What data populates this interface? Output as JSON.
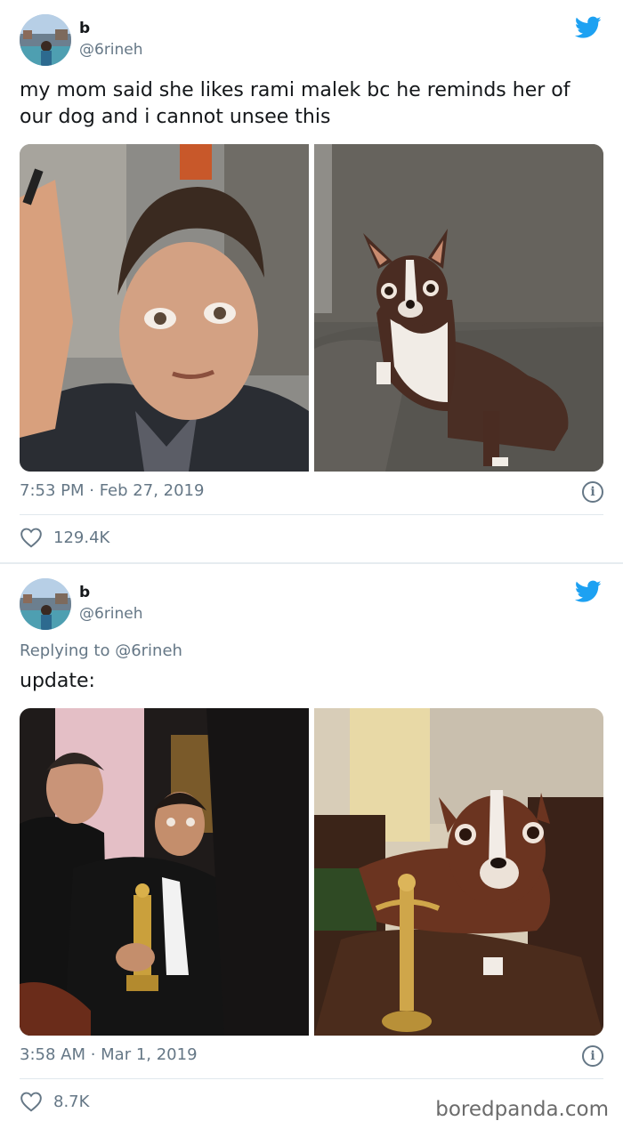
{
  "tweets": [
    {
      "author": {
        "name": "b",
        "handle": "@6rineh"
      },
      "reply_to": "",
      "text": "my mom said she likes rami malek bc he reminds her of our dog and i cannot unsee this",
      "timestamp": "7:53 PM · Feb 27, 2019",
      "likes": "129.4K"
    },
    {
      "author": {
        "name": "b",
        "handle": "@6rineh"
      },
      "reply_to": "Replying to @6rineh",
      "text": "update:",
      "timestamp": "3:58 AM · Mar 1, 2019",
      "likes": "8.7K"
    }
  ],
  "watermark": "boredpanda.com",
  "icons": {
    "brand": "twitter-bird-icon",
    "like": "heart-icon",
    "info": "info-icon"
  },
  "colors": {
    "twitter_blue": "#1da1f2",
    "secondary_text": "#657786",
    "divider": "#e1e8ed"
  }
}
